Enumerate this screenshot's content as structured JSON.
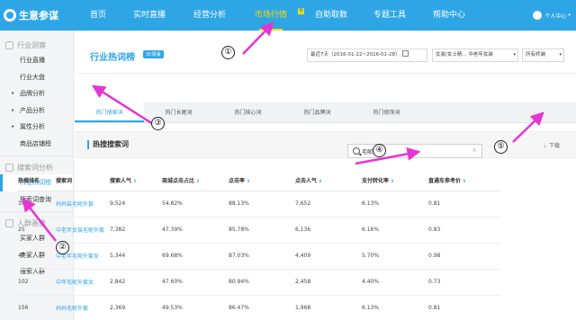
{
  "app": {
    "logo": "生意参谋"
  },
  "nav": {
    "items": [
      "首页",
      "实时直播",
      "经营分析",
      "市场行情",
      "自助取数",
      "专题工具",
      "帮助中心"
    ],
    "active_badge": "专",
    "user_label": "个人中心"
  },
  "sidebar": {
    "group1": "行业洞察",
    "group1_items": [
      "行业直播",
      "行业大盘",
      "品牌分析",
      "产品分析",
      "属性分析",
      "商品店铺榜"
    ],
    "group2": "搜索词分析",
    "group2_items": [
      "行业热词榜",
      "搜索词查询"
    ],
    "group3": "人群画像",
    "group3_items": [
      "买家人群",
      "卖家人群",
      "搜索人群"
    ]
  },
  "page": {
    "title": "行业热词榜",
    "title_tag": "日/周版",
    "date_range": "最近7天（2016-01-22~2016-01-28）",
    "category": "女装/女士精... 中老年女装",
    "terminal": "所有终端"
  },
  "tabs": [
    "热门搜索词",
    "热门长尾词",
    "热门核心词",
    "热门品牌词",
    "热门修饰词"
  ],
  "section": {
    "title": "热搜搜索词",
    "download": "下载"
  },
  "search": {
    "value": "毛呢外套",
    "clear": "×"
  },
  "table": {
    "headers": [
      "热搜排名",
      "搜索词",
      "搜索人气",
      "商城点击占比",
      "点击率",
      "点击人气",
      "支付转化率",
      "直通车参考价"
    ],
    "rows": [
      [
        "18",
        "妈妈装毛呢外套",
        "9,524",
        "54.82%",
        "88.13%",
        "7,652",
        "6.13%",
        "0.81"
      ],
      [
        "25",
        "中老年女装毛呢外套",
        "7,382",
        "47.39%",
        "85.78%",
        "6,136",
        "6.16%",
        "0.83"
      ],
      [
        "47",
        "中老年毛呢外套女",
        "5,344",
        "69.68%",
        "87.03%",
        "4,409",
        "5.70%",
        "0.98"
      ],
      [
        "102",
        "中年毛呢外套女",
        "2,842",
        "47.60%",
        "80.94%",
        "2,458",
        "4.40%",
        "0.73"
      ],
      [
        "156",
        "妈妈毛呢外套",
        "2,369",
        "49.53%",
        "86.47%",
        "1,968",
        "6.13%",
        "0.81"
      ]
    ]
  },
  "annotations": [
    "①",
    "②",
    "③",
    "④",
    "⑤"
  ],
  "colors": {
    "brand": "#2ea6e6",
    "highlight": "#ffd800",
    "arrow": "#e534d4"
  }
}
